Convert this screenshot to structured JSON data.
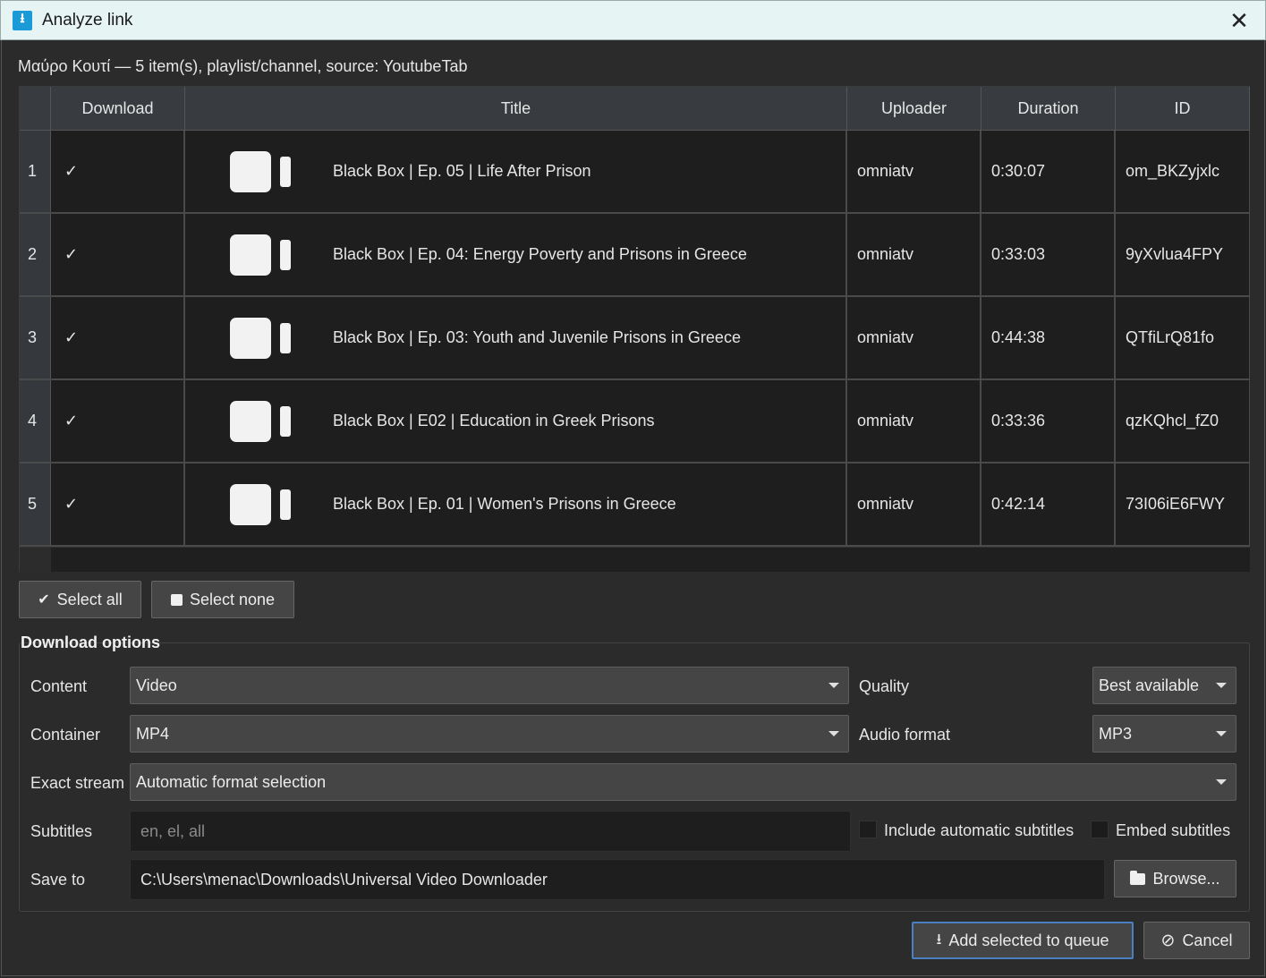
{
  "window": {
    "title": "Analyze link",
    "close_glyph": "✕"
  },
  "summary": "Μαύρο Κουτί — 5 item(s), playlist/channel, source: YoutubeTab",
  "table": {
    "headers": [
      "Download",
      "Title",
      "Uploader",
      "Duration",
      "ID"
    ],
    "rows": [
      {
        "num": "1",
        "download": "✓",
        "title": "Black Box | Ep. 05 | Life After Prison",
        "uploader": "omniatv",
        "duration": "0:30:07",
        "id": "om_BKZyjxlc"
      },
      {
        "num": "2",
        "download": "✓",
        "title": "Black Box | Ep. 04: Energy Poverty and Prisons in Greece",
        "uploader": "omniatv",
        "duration": "0:33:03",
        "id": "9yXvlua4FPY"
      },
      {
        "num": "3",
        "download": "✓",
        "title": "Black Box | Ep. 03: Youth and Juvenile Prisons in Greece",
        "uploader": "omniatv",
        "duration": "0:44:38",
        "id": "QTfiLrQ81fo"
      },
      {
        "num": "4",
        "download": "✓",
        "title": "Black Box | E02 | Education in Greek Prisons",
        "uploader": "omniatv",
        "duration": "0:33:36",
        "id": "qzKQhcl_fZ0"
      },
      {
        "num": "5",
        "download": "✓",
        "title": "Black Box | Ep. 01 | Women's Prisons in Greece",
        "uploader": "omniatv",
        "duration": "0:42:14",
        "id": "73I06iE6FWY"
      }
    ]
  },
  "selection": {
    "select_all": "Select all",
    "select_none": "Select none"
  },
  "options": {
    "heading": "Download options",
    "content_label": "Content",
    "content_value": "Video",
    "quality_label": "Quality",
    "quality_value": "Best available",
    "container_label": "Container",
    "container_value": "MP4",
    "audio_format_label": "Audio format",
    "audio_format_value": "MP3",
    "exact_stream_label": "Exact stream",
    "exact_stream_value": "Automatic format selection",
    "subtitles_label": "Subtitles",
    "subtitles_placeholder": "en, el, all",
    "include_auto_subs": "Include automatic subtitles",
    "include_auto_subs_checked": false,
    "embed_subs": "Embed subtitles",
    "embed_subs_checked": false,
    "save_to_label": "Save to",
    "save_to_value": "C:\\Users\\menac\\Downloads\\Universal Video Downloader",
    "browse": "Browse..."
  },
  "actions": {
    "add_to_queue": "Add selected to queue",
    "cancel": "Cancel"
  },
  "colors": {
    "titlebar_bg": "#e6f4f4",
    "app_icon": "#1a9ad6",
    "window_bg": "#2b2b2b",
    "primary_border": "#4a7fc1"
  },
  "icons": {
    "app": "download-app-icon",
    "row_thumb": "video-camera-icon",
    "check": "checkmark-icon",
    "select_all": "check-double-icon",
    "select_none": "square-icon",
    "browse": "folder-icon",
    "add": "download-icon",
    "cancel": "ban-icon"
  }
}
